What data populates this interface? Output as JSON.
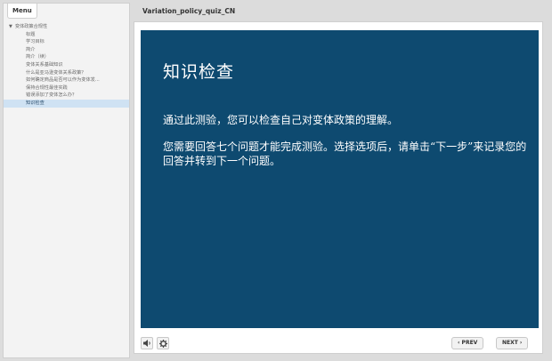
{
  "sidebar": {
    "menu_label": "Menu",
    "items": [
      {
        "label": "变体政策合规性",
        "type": "section"
      },
      {
        "label": "标题",
        "type": "item"
      },
      {
        "label": "学习目标",
        "type": "item"
      },
      {
        "label": "简介",
        "type": "item"
      },
      {
        "label": "简介（续）",
        "type": "item"
      },
      {
        "label": "变体关系基础知识",
        "type": "item"
      },
      {
        "label": "什么是亚马逊变体关系政策？",
        "type": "item"
      },
      {
        "label": "如何确定商品是否可以作为变体发...",
        "type": "item"
      },
      {
        "label": "保持合规性最佳实践",
        "type": "item"
      },
      {
        "label": "错误添加了变体怎么办？",
        "type": "item"
      },
      {
        "label": "知识检查",
        "type": "active"
      }
    ]
  },
  "header": {
    "course_title": "Variation_policy_quiz_CN"
  },
  "slide": {
    "title": "知识检查",
    "paragraph1": "通过此测验，您可以检查自己对变体政策的理解。",
    "paragraph2": "您需要回答七个问题才能完成测验。选择选项后，请单击“下一步”来记录您的回答并转到下一个问题。",
    "background_color": "#0e4a70"
  },
  "toolbar": {
    "volume_icon": "speaker-icon",
    "settings_icon": "gear-icon",
    "prev_label": "‹ PREV",
    "next_label": "NEXT ›"
  }
}
